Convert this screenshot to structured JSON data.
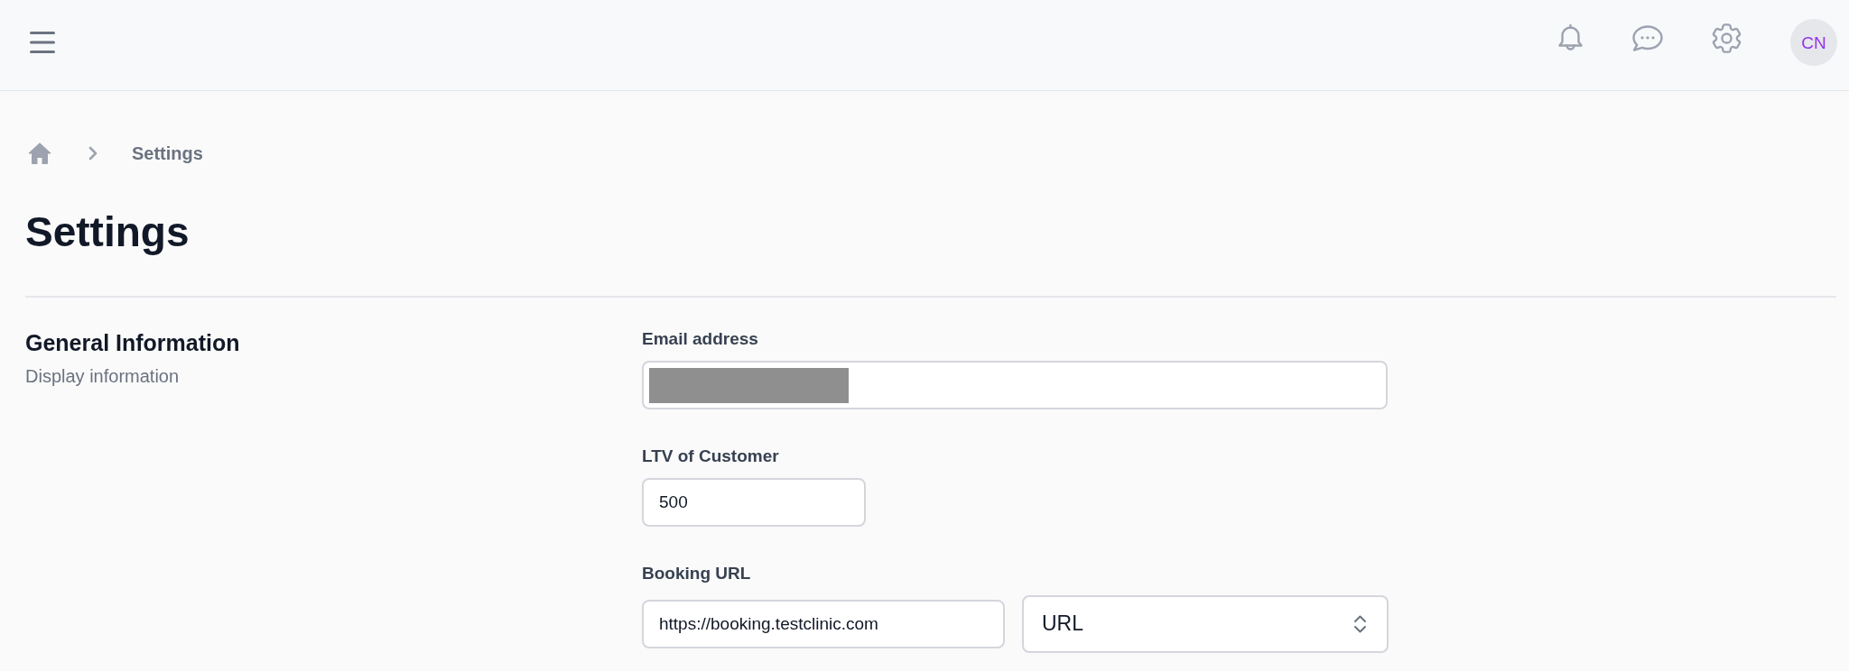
{
  "topbar": {
    "avatar_initials": "CN"
  },
  "breadcrumb": [
    "Settings"
  ],
  "page_title": "Settings",
  "section": {
    "title": "General Information",
    "subtitle": "Display information",
    "fields": [
      {
        "kind": "email",
        "label": "Email address",
        "redacted": true
      },
      {
        "kind": "number",
        "label": "LTV of Customer",
        "value": "500"
      },
      {
        "kind": "url",
        "label": "Booking URL",
        "value": "https://booking.testclinic.com",
        "type_select": "URL"
      }
    ]
  }
}
